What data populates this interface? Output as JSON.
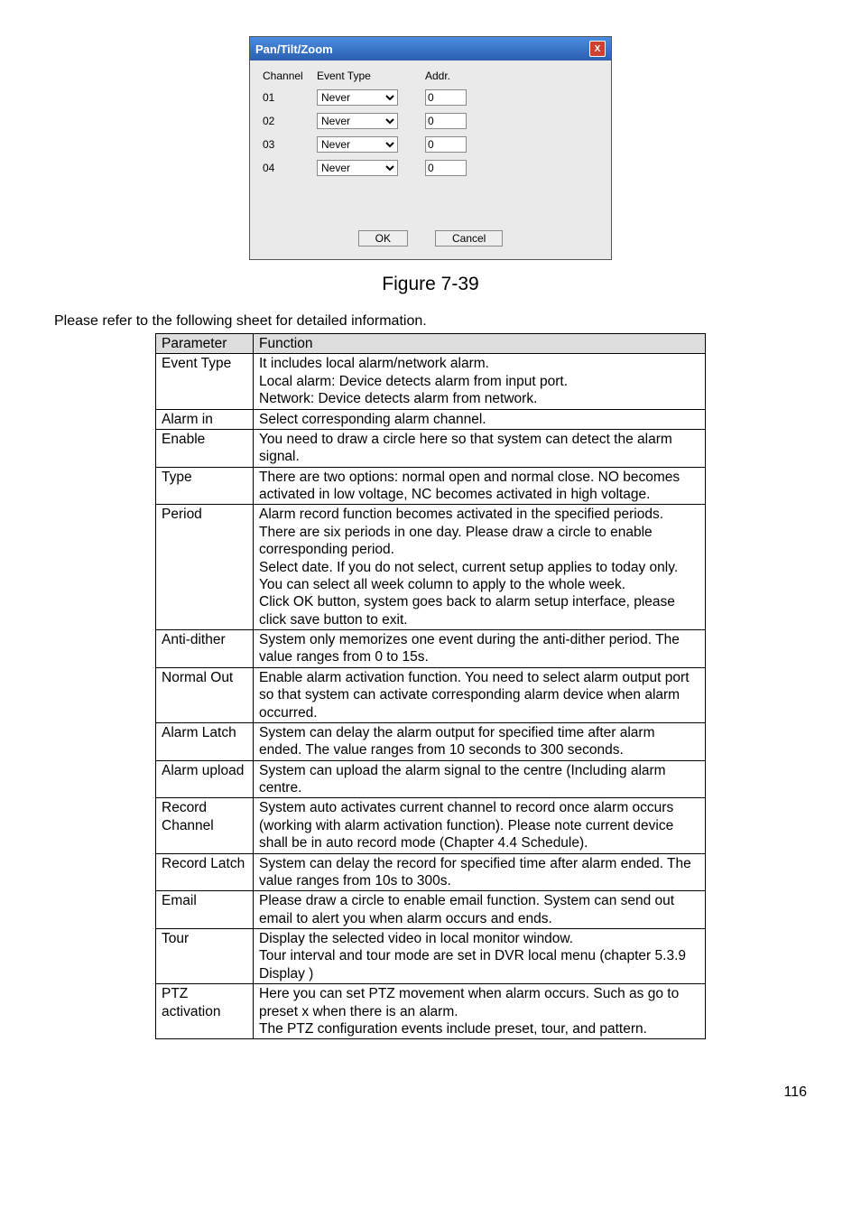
{
  "dialog": {
    "title": "Pan/Tilt/Zoom",
    "close_label": "X",
    "head_channel": "Channel",
    "head_event": "Event Type",
    "head_addr": "Addr.",
    "rows": [
      {
        "ch": "01",
        "event": "Never",
        "addr": "0"
      },
      {
        "ch": "02",
        "event": "Never",
        "addr": "0"
      },
      {
        "ch": "03",
        "event": "Never",
        "addr": "0"
      },
      {
        "ch": "04",
        "event": "Never",
        "addr": "0"
      }
    ],
    "ok": "OK",
    "cancel": "Cancel"
  },
  "figure_caption": "Figure 7-39",
  "intro": "Please refer to the following sheet for detailed information.",
  "table": {
    "head_param": "Parameter",
    "head_func": "Function",
    "rows": [
      {
        "p": "Event Type",
        "f": "It includes local alarm/network alarm.\nLocal alarm: Device detects alarm from input port.\nNetwork: Device detects alarm from network."
      },
      {
        "p": "Alarm in",
        "f": "Select corresponding alarm channel."
      },
      {
        "p": "Enable",
        "f": "You need to draw a circle here so that system can detect the alarm signal."
      },
      {
        "p": "Type",
        "f": "There are two options: normal open and normal close. NO becomes activated in low voltage, NC becomes activated in high voltage."
      },
      {
        "p": "Period",
        "f": "Alarm record function becomes activated in the specified periods. There are six periods in one day. Please draw a circle to enable corresponding period.\nSelect date. If you do not select, current setup applies to today only. You can select all week column to apply to the whole week.\nClick OK button, system goes back to alarm setup interface, please click save button to exit."
      },
      {
        "p": "Anti-dither",
        "f": "System only memorizes one event during the anti-dither period. The value ranges from 0 to 15s."
      },
      {
        "p": "Normal Out",
        "f": "Enable alarm activation function. You need to select alarm output port so that system can activate corresponding alarm device when alarm occurred."
      },
      {
        "p": "Alarm Latch",
        "f": "System can delay the alarm output for specified time after alarm ended. The value ranges from 10 seconds to 300 seconds."
      },
      {
        "p": "Alarm upload",
        "f": "System can upload the alarm signal to the centre (Including alarm centre."
      },
      {
        "p": "Record Channel",
        "f": "System auto activates current channel to record once alarm occurs (working with alarm activation function). Please note current device shall be in auto record mode (Chapter 4.4 Schedule)."
      },
      {
        "p": "Record Latch",
        "f": "System can delay the record for specified time after alarm ended. The value ranges from 10s to 300s."
      },
      {
        "p": "Email",
        "f": "Please draw a circle to enable email function. System can send out email to alert you when alarm occurs and ends."
      },
      {
        "p": "Tour",
        "f": "Display the selected video in local monitor window.\nTour interval and tour mode are set in DVR local menu (chapter 5.3.9 Display )"
      },
      {
        "p": "PTZ activation",
        "f": "Here you can set PTZ movement when alarm occurs. Such as go to preset x when there is an alarm.\nThe PTZ configuration events include preset, tour, and pattern."
      }
    ]
  },
  "page_number": "116"
}
